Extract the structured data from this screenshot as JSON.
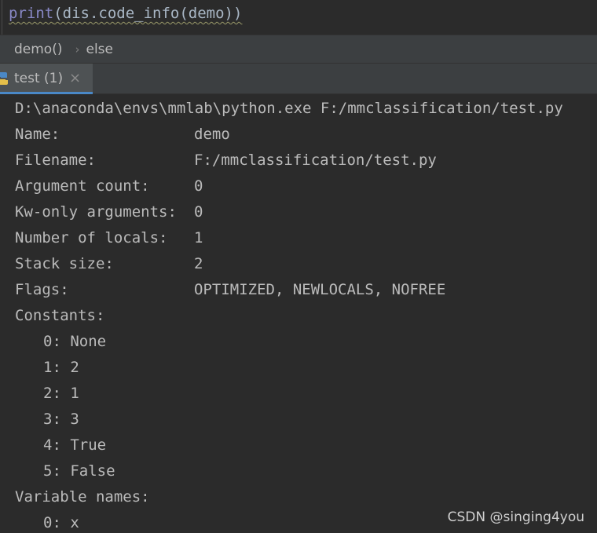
{
  "editor": {
    "code_fn": "print",
    "code_rest": "(dis.code_info(demo))"
  },
  "breadcrumb": {
    "items": [
      "demo()",
      "else"
    ]
  },
  "run_tab": {
    "label": "test (1)",
    "close": "×",
    "icon": "python-icon"
  },
  "console": {
    "command": "D:\\anaconda\\envs\\mmlab\\python.exe F:/mmclassification/test.py",
    "fields": [
      {
        "label": "Name:",
        "value": "demo"
      },
      {
        "label": "Filename:",
        "value": "F:/mmclassification/test.py"
      },
      {
        "label": "Argument count:",
        "value": "0"
      },
      {
        "label": "Kw-only arguments:",
        "value": "0"
      },
      {
        "label": "Number of locals:",
        "value": "1"
      },
      {
        "label": "Stack size:",
        "value": "2"
      },
      {
        "label": "Flags:",
        "value": "OPTIMIZED, NEWLOCALS, NOFREE"
      }
    ],
    "constants_header": "Constants:",
    "constants": [
      "0: None",
      "1: 2",
      "2: 1",
      "3: 3",
      "4: True",
      "5: False"
    ],
    "varnames_header": "Variable names:",
    "varnames": [
      "0: x"
    ]
  },
  "watermark": "CSDN @singing4you",
  "colors": {
    "background": "#2b2b2b",
    "toolbar": "#3c3f41",
    "active_tab": "#4e5254",
    "accent": "#4a88c7",
    "builtin_fn": "#8888c6"
  }
}
